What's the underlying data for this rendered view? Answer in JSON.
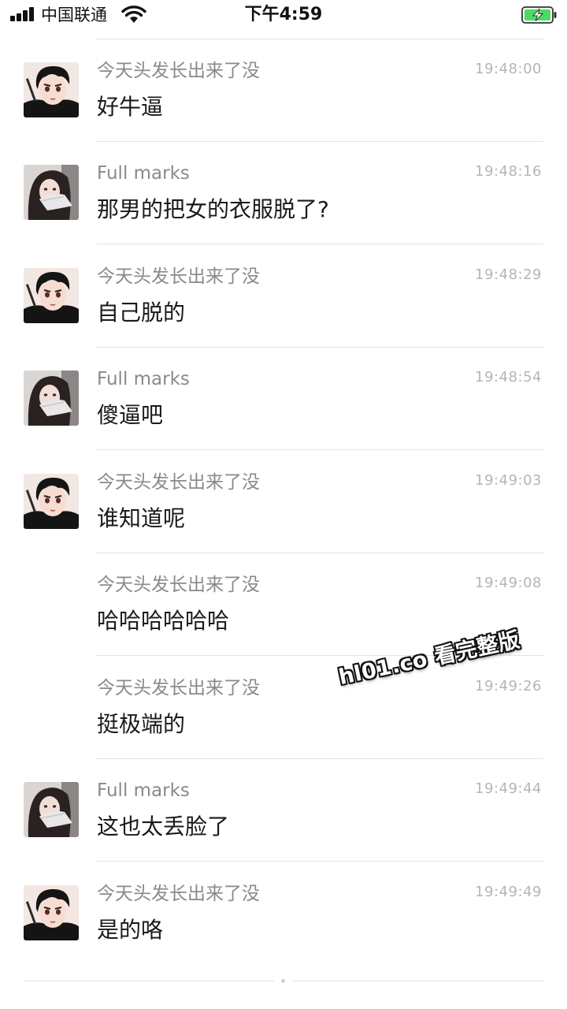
{
  "status_bar": {
    "carrier": "中国联通",
    "time": "下午4:59",
    "icons": [
      "signal-icon",
      "wifi-icon",
      "battery-charging-icon"
    ],
    "battery_color": "#4cd964"
  },
  "messages": [
    {
      "sender": "今天头发长出来了没",
      "time": "19:48:00",
      "text": "好牛逼",
      "avatar": "boy"
    },
    {
      "sender": "Full marks",
      "time": "19:48:16",
      "text": "那男的把女的衣服脱了?",
      "avatar": "girl"
    },
    {
      "sender": "今天头发长出来了没",
      "time": "19:48:29",
      "text": "自己脱的",
      "avatar": "boy"
    },
    {
      "sender": "Full marks",
      "time": "19:48:54",
      "text": "傻逼吧",
      "avatar": "girl"
    },
    {
      "sender": "今天头发长出来了没",
      "time": "19:49:03",
      "text": "谁知道呢",
      "avatar": "boy"
    },
    {
      "sender": "今天头发长出来了没",
      "time": "19:49:08",
      "text": "哈哈哈哈哈哈",
      "avatar": "none"
    },
    {
      "sender": "今天头发长出来了没",
      "time": "19:49:26",
      "text": "挺极端的",
      "avatar": "none"
    },
    {
      "sender": "Full marks",
      "time": "19:49:44",
      "text": "这也太丢脸了",
      "avatar": "girl"
    },
    {
      "sender": "今天头发长出来了没",
      "time": "19:49:49",
      "text": "是的咯",
      "avatar": "boy"
    }
  ],
  "watermark": "hl01.co 看完整版"
}
